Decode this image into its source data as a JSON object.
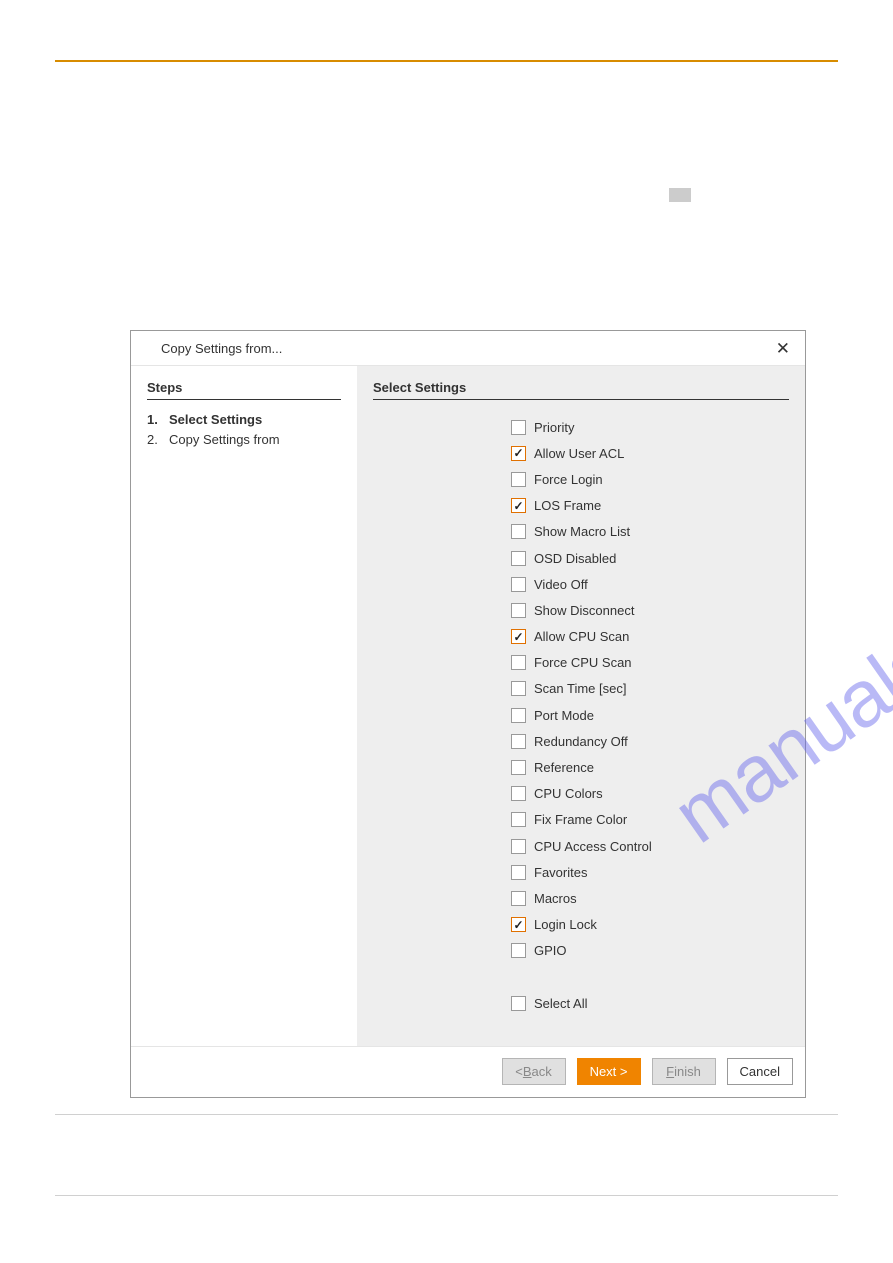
{
  "dialog": {
    "title": "Copy Settings from...",
    "steps_heading": "Steps",
    "steps": [
      {
        "num": "1.",
        "label": "Select Settings",
        "current": true
      },
      {
        "num": "2.",
        "label": "Copy Settings from",
        "current": false
      }
    ],
    "settings_heading": "Select Settings",
    "options": [
      {
        "label": "Priority",
        "checked": false
      },
      {
        "label": "Allow User ACL",
        "checked": true
      },
      {
        "label": "Force Login",
        "checked": false
      },
      {
        "label": "LOS Frame",
        "checked": true
      },
      {
        "label": "Show Macro List",
        "checked": false
      },
      {
        "label": "OSD Disabled",
        "checked": false
      },
      {
        "label": "Video Off",
        "checked": false
      },
      {
        "label": "Show Disconnect",
        "checked": false
      },
      {
        "label": "Allow CPU Scan",
        "checked": true
      },
      {
        "label": "Force CPU Scan",
        "checked": false
      },
      {
        "label": "Scan Time [sec]",
        "checked": false
      },
      {
        "label": "Port Mode",
        "checked": false
      },
      {
        "label": "Redundancy Off",
        "checked": false
      },
      {
        "label": "Reference",
        "checked": false
      },
      {
        "label": "CPU Colors",
        "checked": false
      },
      {
        "label": "Fix Frame Color",
        "checked": false
      },
      {
        "label": "CPU Access Control",
        "checked": false
      },
      {
        "label": "Favorites",
        "checked": false
      },
      {
        "label": "Macros",
        "checked": false
      },
      {
        "label": "Login Lock",
        "checked": true
      },
      {
        "label": "GPIO",
        "checked": false
      }
    ],
    "select_all_label": "Select All",
    "select_all_checked": false,
    "buttons": {
      "back_prefix": "< ",
      "back_letter": "B",
      "back_rest": "ack",
      "next": "Next >",
      "finish_letter": "F",
      "finish_rest": "inish",
      "cancel": "Cancel"
    }
  },
  "watermark": "manualshive.com"
}
